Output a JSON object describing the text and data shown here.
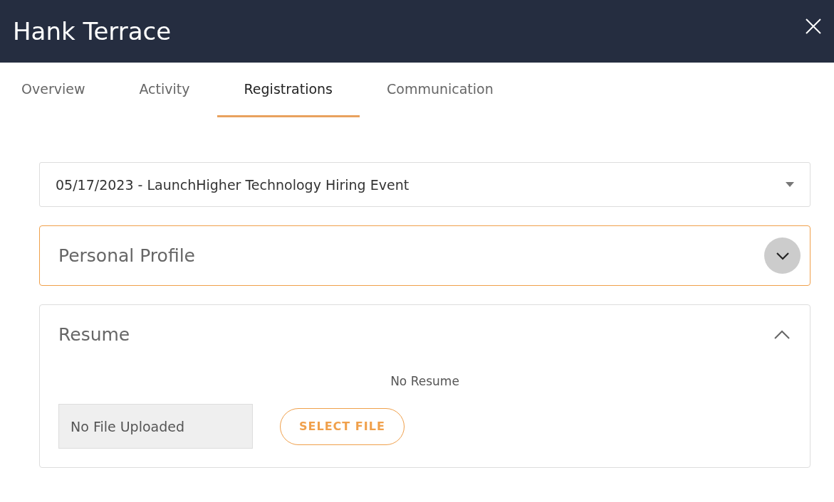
{
  "window": {
    "title": "Hank Terrace"
  },
  "tabs": [
    {
      "label": "Overview",
      "selected": false
    },
    {
      "label": "Activity",
      "selected": false
    },
    {
      "label": "Registrations",
      "selected": true
    },
    {
      "label": "Communication",
      "selected": false
    }
  ],
  "event_select": {
    "value": "05/17/2023 - LaunchHigher Technology Hiring Event"
  },
  "sections": [
    {
      "title": "Personal Profile",
      "expanded": false,
      "focused": true
    },
    {
      "title": "Resume",
      "expanded": true,
      "focused": false,
      "message": "No Resume",
      "file_field": {
        "value": "No File Uploaded"
      },
      "button": "SELECT FILE"
    }
  ]
}
